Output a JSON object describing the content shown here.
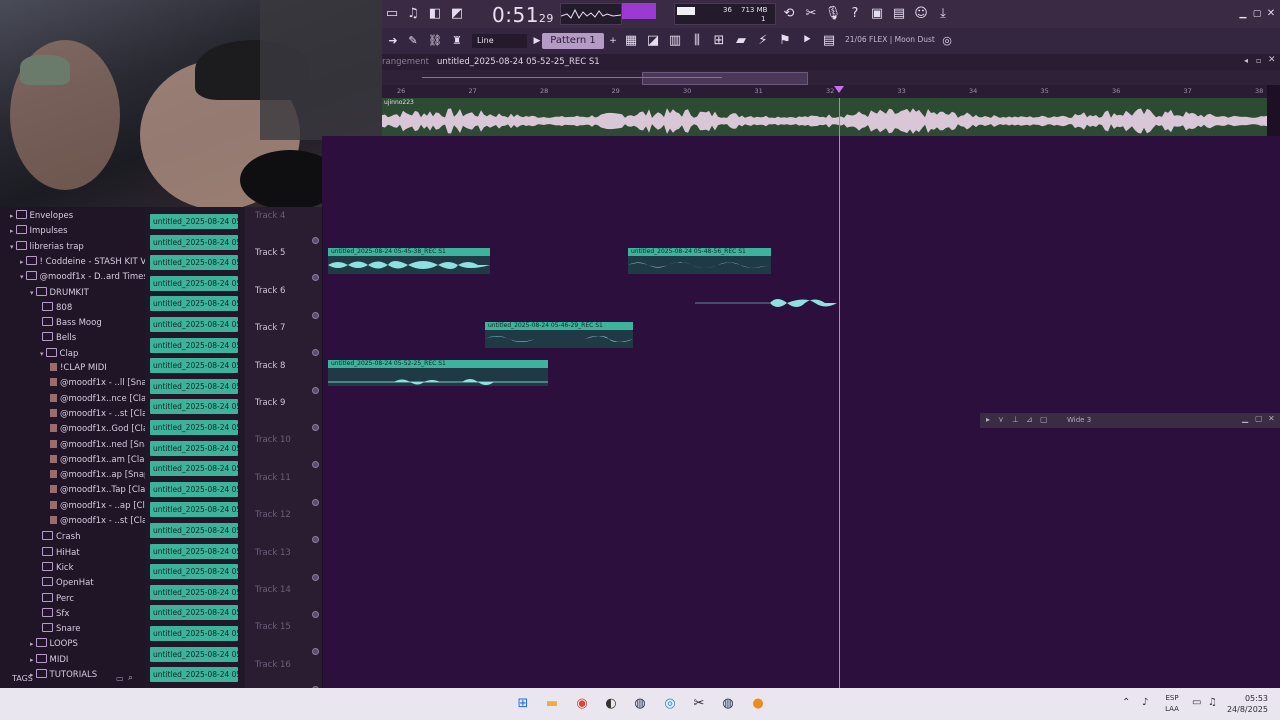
{
  "toolbar": {
    "time": "0:51",
    "time_sub": "29",
    "snap": "Line",
    "pattern": "Pattern 1",
    "cpu": "36",
    "memory": "713 MB",
    "voices": "1",
    "plugin_hint": "21/06  FLEX | Moon Dust"
  },
  "playlist": {
    "section_label": "rangement",
    "title": "untitled_2025-08-24 05-52-25_REC S1",
    "strip_label": "ujinno223",
    "ruler": [
      "26",
      "27",
      "28",
      "29",
      "30",
      "31",
      "32",
      "33",
      "34",
      "35",
      "36",
      "37",
      "38"
    ]
  },
  "browser": {
    "items": [
      {
        "label": "Envelopes",
        "type": "folder",
        "depth": 0
      },
      {
        "label": "Impulses",
        "type": "folder",
        "depth": 0
      },
      {
        "label": "librerias trap",
        "type": "folder",
        "depth": 0
      },
      {
        "label": "! Coddeine - STASH KIT V3 !",
        "type": "folder",
        "depth": 1
      },
      {
        "label": "@moodf1x - D..ard Times_",
        "type": "folder",
        "depth": 1
      },
      {
        "label": "DRUMKIT",
        "type": "folder",
        "depth": 2
      },
      {
        "label": "808",
        "type": "folder",
        "depth": 3
      },
      {
        "label": "Bass Moog",
        "type": "folder",
        "depth": 3
      },
      {
        "label": "Bells",
        "type": "folder",
        "depth": 3
      },
      {
        "label": "Clap",
        "type": "folder",
        "depth": 3
      },
      {
        "label": "!CLAP MIDI",
        "type": "file",
        "depth": 4
      },
      {
        "label": "@moodf1x - ..ll [Snap]",
        "type": "file",
        "depth": 4
      },
      {
        "label": "@moodf1x..nce [Clap]",
        "type": "file",
        "depth": 4
      },
      {
        "label": "@moodf1x - ..st [Clap]",
        "type": "file",
        "depth": 4
      },
      {
        "label": "@moodf1x..God [Clap]",
        "type": "file",
        "depth": 4
      },
      {
        "label": "@moodf1x..ned [Snap]",
        "type": "file",
        "depth": 4
      },
      {
        "label": "@moodf1x..am [Clap]",
        "type": "file",
        "depth": 4
      },
      {
        "label": "@moodf1x..ap [Snap]",
        "type": "file",
        "depth": 4
      },
      {
        "label": "@moodf1x..Tap [Clap]",
        "type": "file",
        "depth": 4
      },
      {
        "label": "@moodf1x - ..ap [Clap]",
        "type": "file",
        "depth": 4
      },
      {
        "label": "@moodf1x - ..st [Clap]",
        "type": "file",
        "depth": 4
      },
      {
        "label": "Crash",
        "type": "folder",
        "depth": 3
      },
      {
        "label": "HiHat",
        "type": "folder",
        "depth": 3
      },
      {
        "label": "Kick",
        "type": "folder",
        "depth": 3
      },
      {
        "label": "OpenHat",
        "type": "folder",
        "depth": 3
      },
      {
        "label": "Perc",
        "type": "folder",
        "depth": 3
      },
      {
        "label": "Sfx",
        "type": "folder",
        "depth": 3
      },
      {
        "label": "Snare",
        "type": "folder",
        "depth": 3
      },
      {
        "label": "LOOPS",
        "type": "folder",
        "depth": 2
      },
      {
        "label": "MIDI",
        "type": "folder",
        "depth": 2
      },
      {
        "label": "TUTORIALS",
        "type": "folder",
        "depth": 2
      }
    ],
    "tags_label": "TAGS"
  },
  "channels": {
    "label": "untitled_2025-08-24 05-",
    "count": 23
  },
  "tracks": [
    {
      "label": "Track 4"
    },
    {
      "label": "Track 5"
    },
    {
      "label": "Track 6"
    },
    {
      "label": "Track 7"
    },
    {
      "label": "Track 8"
    },
    {
      "label": "Track 9"
    },
    {
      "label": "Track 10"
    },
    {
      "label": "Track 11"
    },
    {
      "label": "Track 12"
    },
    {
      "label": "Track 13"
    },
    {
      "label": "Track 14"
    },
    {
      "label": "Track 15"
    },
    {
      "label": "Track 16"
    }
  ],
  "clips": [
    {
      "label": "untitled_2025-08-24 05-45-38_REC S1"
    },
    {
      "label": "untitled_2025-08-24 05-48-56_REC S1"
    },
    {
      "label": "untitled_2025-08-24 05-46-29_REC S1"
    },
    {
      "label": "untitled_2025-08-24 05-52-25_REC S1"
    }
  ],
  "mini_window": {
    "label": "Wide 3"
  },
  "taskbar": {
    "lang_top": "ESP",
    "lang_bottom": "LAA",
    "time": "05:53",
    "date": "24/8/2025"
  },
  "colors": {
    "accent": "#c770f0",
    "clip": "#3cb39a",
    "playlist_bg": "#2d0f3d"
  }
}
